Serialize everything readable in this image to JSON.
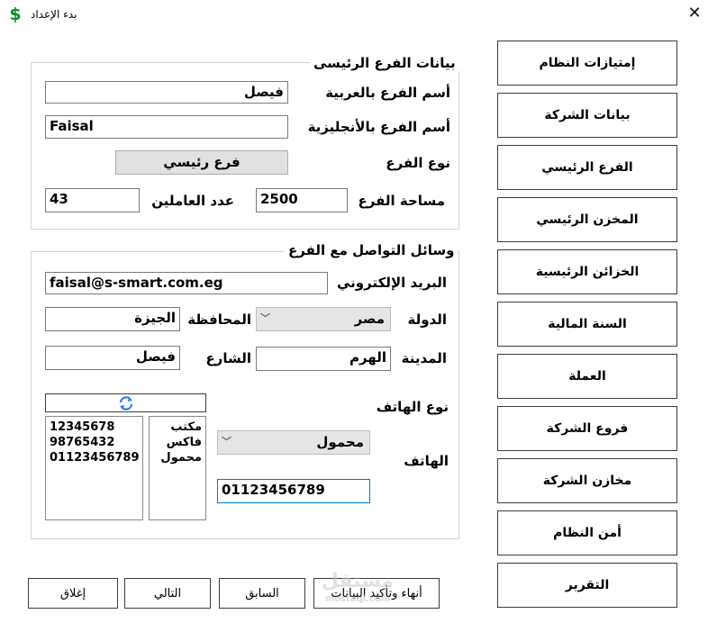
{
  "window": {
    "title": "بدء الإعداد",
    "app_icon": "$",
    "close": "✕"
  },
  "branch_group": {
    "title": "بيانات الفرع الرئيسى",
    "name_ar_label": "أسم الفرع بالعربية",
    "name_ar_value": "فيصل",
    "name_en_label": "أسم الفرع بالأنجليزية",
    "name_en_value": "Faisal",
    "type_label": "نوع الفرع",
    "type_button": "فرع رئيسي",
    "area_label": "مساحة الفرع",
    "area_value": "2500",
    "workers_label": "عدد العاملين",
    "workers_value": "43"
  },
  "contact_group": {
    "title": "وسائل التواصل مع الفرع",
    "email_label": "البريد الإلكتروني",
    "email_value": "faisal@s-smart.com.eg",
    "country_label": "الدولة",
    "country_value": "مصر",
    "governorate_label": "المحافظة",
    "governorate_value": "الجيزة",
    "city_label": "المدينة",
    "city_value": "الهرم",
    "street_label": "الشارع",
    "street_value": "فيصل",
    "phone_type_label": "نوع الهاتف",
    "phone_type_value": "محمول",
    "phone_label": "الهاتف",
    "phone_value": "01123456789",
    "phone_numbers": [
      "12345678",
      "98765432",
      "01123456789"
    ],
    "phone_types": [
      "مكتب",
      "فاكس",
      "محمول"
    ]
  },
  "nav": [
    "إمتيازات النظام",
    "بيانات الشركة",
    "الفرع الرئيسي",
    "المخزن الرئيسي",
    "الخزائن الرئيسية",
    "السنة المالية",
    "العملة",
    "فروع الشركة",
    "مخازن الشركة",
    "أمن النظام",
    "التقرير"
  ],
  "bottom": {
    "finish": "أنهاء وتأكيد البيانات",
    "previous": "السابق",
    "next": "التالي",
    "close": "إغلاق"
  },
  "watermark": {
    "main": "مستقل",
    "sub": "mostaql.com"
  },
  "colors": {
    "accent": "#0078d7",
    "icon_green": "#0a8a2a"
  }
}
